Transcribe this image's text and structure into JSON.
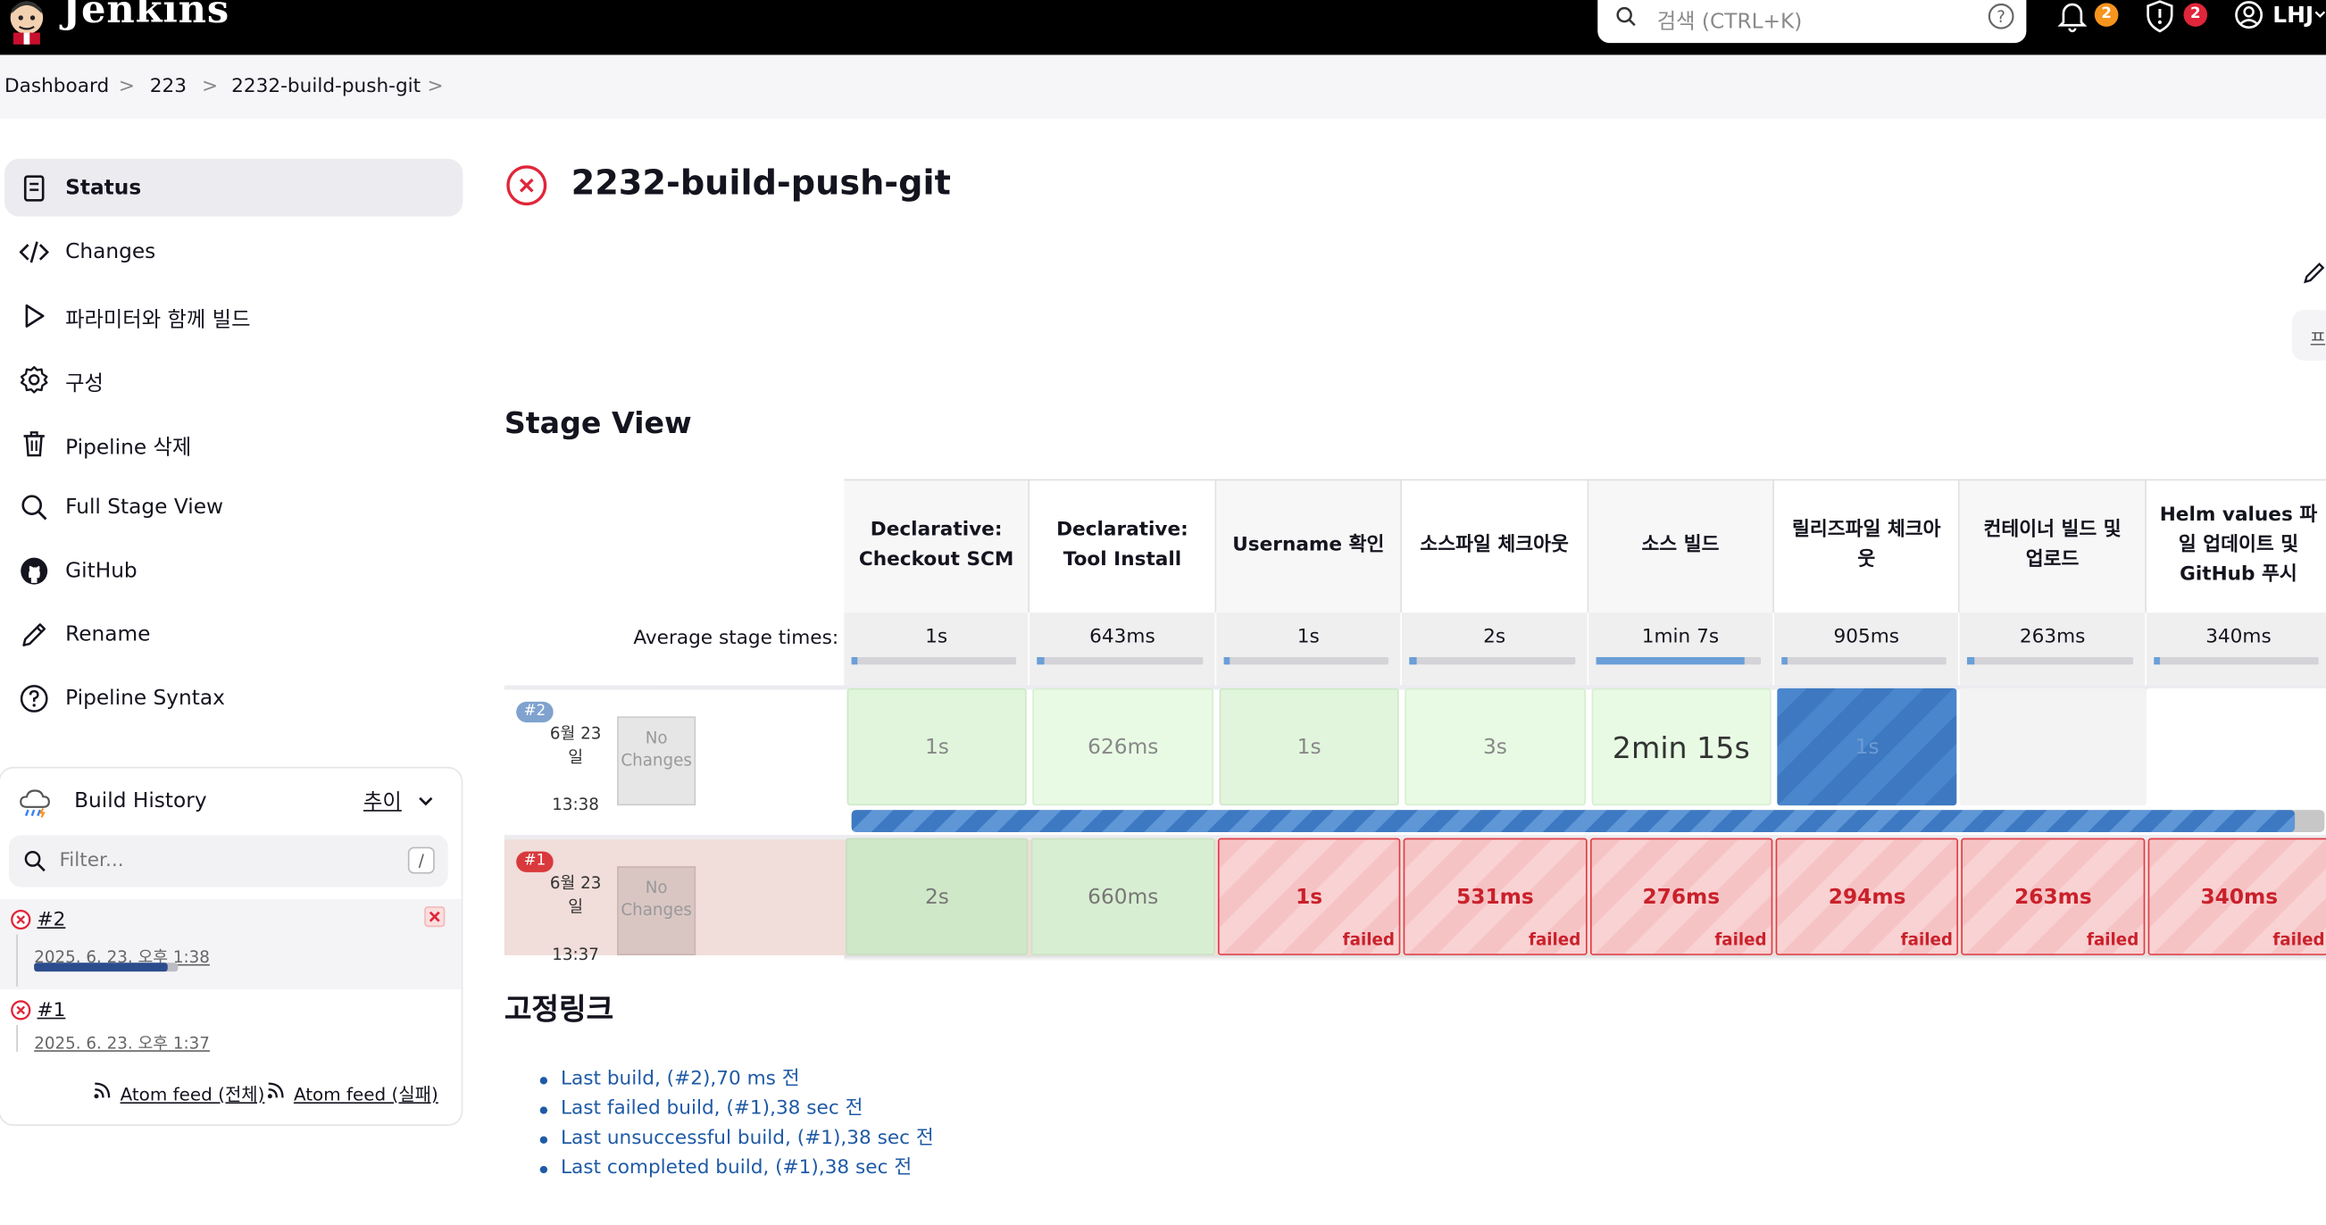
{
  "header": {
    "brand": "Jenkins",
    "search_placeholder": "검색 (CTRL+K)",
    "notifications_count": "2",
    "security_count": "2",
    "user": "LHJ",
    "colors": {
      "bar": "#000000",
      "notif_badge": "#f7941d",
      "security_badge": "#e0263a"
    }
  },
  "breadcrumb": [
    "Dashboard",
    "223",
    "2232-build-push-git"
  ],
  "sidebar": {
    "items": [
      {
        "label": "Status",
        "icon": "status-icon",
        "active": true
      },
      {
        "label": "Changes",
        "icon": "code-icon"
      },
      {
        "label": "파라미터와 함께 빌드",
        "icon": "play-icon"
      },
      {
        "label": "구성",
        "icon": "gear-icon"
      },
      {
        "label": "Pipeline 삭제",
        "icon": "trash-icon"
      },
      {
        "label": "Full Stage View",
        "icon": "search-icon"
      },
      {
        "label": "GitHub",
        "icon": "github-icon"
      },
      {
        "label": "Rename",
        "icon": "pencil-icon"
      },
      {
        "label": "Pipeline Syntax",
        "icon": "help-icon"
      }
    ]
  },
  "build_history": {
    "title": "Build History",
    "trend": "추이",
    "filter_placeholder": "Filter...",
    "filter_shortcut": "/",
    "builds": [
      {
        "number": "#2",
        "date": "2025. 6. 23. 오후 1:38",
        "status": "failed",
        "progress": 0.93
      },
      {
        "number": "#1",
        "date": "2025. 6. 23. 오후 1:37",
        "status": "failed"
      }
    ],
    "atom_all": "Atom feed (전체)",
    "atom_fail": "Atom feed (실패)"
  },
  "job": {
    "title": "2232-build-push-git",
    "status": "failed",
    "edge_tab": "프"
  },
  "stage_view": {
    "title": "Stage View",
    "avg_label": "Average stage times:",
    "stages": [
      {
        "name": "Declarative: Checkout SCM",
        "avg": "1s",
        "avg_frac": 0.02
      },
      {
        "name": "Declarative: Tool Install",
        "avg": "643ms",
        "avg_frac": 0.01
      },
      {
        "name": "Username 확인",
        "avg": "1s",
        "avg_frac": 0.02
      },
      {
        "name": "소스파일 체크아웃",
        "avg": "2s",
        "avg_frac": 0.03
      },
      {
        "name": "소스 빌드",
        "avg": "1min 7s",
        "avg_frac": 0.9
      },
      {
        "name": "릴리즈파일 체크아웃",
        "avg": "905ms",
        "avg_frac": 0.01
      },
      {
        "name": "컨테이너 빌드 및 업로드",
        "avg": "263ms",
        "avg_frac": 0.005
      },
      {
        "name": "Helm values 파일 업데이트 및 GitHub 푸시",
        "avg": "340ms",
        "avg_frac": 0.005
      }
    ],
    "runs": [
      {
        "tag": "#2",
        "date": "6월 23 일",
        "time": "13:38",
        "changes": "No Changes",
        "cells": [
          "1s",
          "626ms",
          "1s",
          "3s",
          "2min 15s",
          "1s",
          "",
          ""
        ],
        "progress": 0.98
      },
      {
        "tag": "#1",
        "date": "6월 23 일",
        "time": "13:37",
        "changes": "No Changes",
        "cells": [
          "2s",
          "660ms",
          "1s",
          "531ms",
          "276ms",
          "294ms",
          "263ms",
          "340ms"
        ],
        "failed_label": "failed"
      }
    ]
  },
  "permalinks": {
    "title": "고정링크",
    "links": [
      "Last build, (#2),70 ms 전",
      "Last failed build, (#1),38 sec 전",
      "Last unsuccessful build, (#1),38 sec 전",
      "Last completed build, (#1),38 sec 전"
    ]
  }
}
